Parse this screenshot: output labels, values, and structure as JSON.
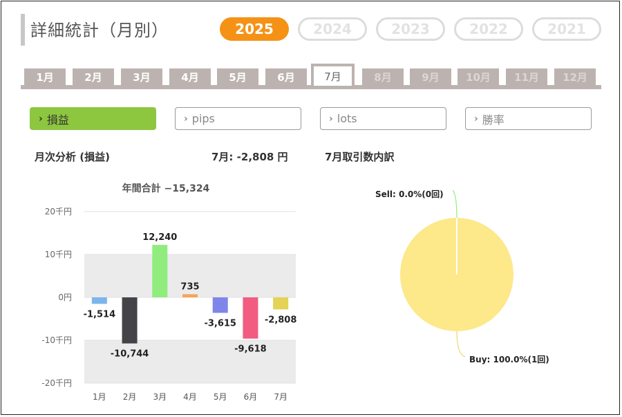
{
  "page": {
    "title": "詳細統計（月別）",
    "years": [
      "2025",
      "2024",
      "2023",
      "2022",
      "2021"
    ],
    "active_year": "2025",
    "months": [
      "1月",
      "2月",
      "3月",
      "4月",
      "5月",
      "6月",
      "7月",
      "8月",
      "9月",
      "10月",
      "11月",
      "12月"
    ],
    "active_month_index": 6,
    "metrics": [
      "損益",
      "pips",
      "lots",
      "勝率"
    ],
    "active_metric_index": 0,
    "heading_left": "月次分析 (損益)",
    "heading_mid": "7月:  -2,808 円",
    "heading_right": "7月取引数内訳"
  },
  "colors": {
    "accent_orange": "#f59216",
    "accent_green": "#8dc63f",
    "tab_gray": "#bcb3b0"
  },
  "chart_data": [
    {
      "type": "bar",
      "title": "年間合計 −15,324",
      "categories": [
        "1月",
        "2月",
        "3月",
        "4月",
        "5月",
        "6月",
        "7月"
      ],
      "values": [
        -1514,
        -10744,
        12240,
        735,
        -3615,
        -9618,
        -2808
      ],
      "value_labels": [
        "-1,514",
        "-10,744",
        "12,240",
        "735",
        "-3,615",
        "-9,618",
        "-2,808"
      ],
      "colors": [
        "#7cb5ec",
        "#434348",
        "#90ed7d",
        "#f7a35c",
        "#8085e9",
        "#f15c80",
        "#e4d354"
      ],
      "ylim": [
        -20000,
        20000
      ],
      "yticks": [
        20000,
        10000,
        0,
        -10000,
        -20000
      ],
      "ytick_labels": [
        "20千円",
        "10千円",
        "0円",
        "-10千円",
        "-20千円"
      ],
      "grid": true
    },
    {
      "type": "pie",
      "labels": [
        "Sell: 0.0%(0回)",
        "Buy: 100.0%(1回)"
      ],
      "values": [
        0,
        100
      ],
      "colors": [
        "#90ed7d",
        "#fde88a"
      ]
    }
  ]
}
